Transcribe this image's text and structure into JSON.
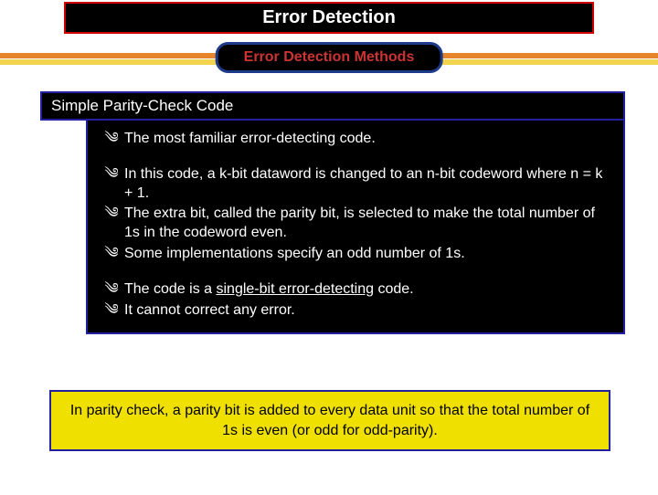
{
  "title": "Error Detection",
  "subtitle": "Error Detection Methods",
  "section_header": "Simple Parity-Check Code",
  "bullets": {
    "b0": "The most familiar error-detecting code.",
    "b1": "In this code, a k-bit dataword is changed to an n-bit codeword where n = k + 1.",
    "b2": "The extra bit, called the parity bit, is selected to make the total number of 1s in the codeword even.",
    "b3": "Some implementations specify an odd number of 1s.",
    "b4_pre": "The code is a ",
    "b4_underlined": "single-bit error-detecting",
    "b4_post": " code.",
    "b5": "It cannot correct any error."
  },
  "footer": "In parity check, a parity bit is added to every data unit so that the total number of 1s is even (or odd for odd-parity).",
  "bullet_glyph": "༄"
}
